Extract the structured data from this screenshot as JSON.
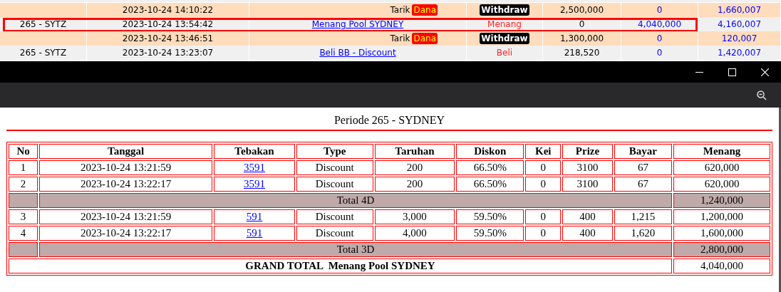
{
  "ledger": {
    "rows": [
      {
        "kind": "withdraw",
        "column_1": "",
        "tanggal": "2023-10-24 14:10:22",
        "keterangan": "Tarik",
        "badge": "Dana",
        "status": "Withdraw",
        "debit": "2,500,000",
        "credit": "0",
        "saldo": "1,660,007",
        "selected": false
      },
      {
        "kind": "game",
        "column_1": "265 - SYTZ",
        "tanggal": "2023-10-24 13:54:42",
        "keterangan": "Menang Pool SYDNEY",
        "status": "Menang",
        "debit": "0",
        "credit": "4,040,000",
        "saldo": "4,160,007",
        "selected": true
      },
      {
        "kind": "withdraw",
        "column_1": "",
        "tanggal": "2023-10-24 13:46:51",
        "keterangan": "Tarik",
        "badge": "Dana",
        "status": "Withdraw",
        "debit": "1,300,000",
        "credit": "0",
        "saldo": "120,007",
        "selected": false
      },
      {
        "kind": "game",
        "column_1": "265 - SYTZ",
        "tanggal": "2023-10-24 13:23:07",
        "keterangan": "Beli BB - Discount",
        "status": "Beli",
        "debit": "218,520",
        "credit": "0",
        "saldo": "1,420,007",
        "selected": false
      }
    ]
  },
  "popup": {
    "title": "Periode 265 - SYDNEY",
    "columns": [
      "No",
      "Tanggal",
      "Tebakan",
      "Type",
      "Taruhan",
      "Diskon",
      "Kei",
      "Prize",
      "Bayar",
      "Menang"
    ],
    "rows": [
      {
        "kind": "entry",
        "cells": [
          "1",
          "2023-10-24 13:21:59",
          "3591",
          "Discount",
          "200",
          "66.50%",
          "0",
          "3100",
          "67",
          "620,000"
        ]
      },
      {
        "kind": "entry",
        "cells": [
          "2",
          "2023-10-24 13:22:17",
          "3591",
          "Discount",
          "200",
          "66.50%",
          "0",
          "3100",
          "67",
          "620,000"
        ]
      },
      {
        "kind": "subtotal",
        "label": "Total 4D",
        "value": "1,240,000"
      },
      {
        "kind": "entry",
        "cells": [
          "3",
          "2023-10-24 13:21:59",
          "591",
          "Discount",
          "3,000",
          "59.50%",
          "0",
          "400",
          "1,215",
          "1,200,000"
        ]
      },
      {
        "kind": "entry",
        "cells": [
          "4",
          "2023-10-24 13:22:17",
          "591",
          "Discount",
          "4,000",
          "59.50%",
          "0",
          "400",
          "1,620",
          "1,600,000"
        ]
      },
      {
        "kind": "subtotal",
        "label": "Total 3D",
        "value": "2,800,000"
      },
      {
        "kind": "grand_total",
        "label": "GRAND TOTAL  Menang Pool SYDNEY",
        "value": "4,040,000"
      }
    ]
  }
}
